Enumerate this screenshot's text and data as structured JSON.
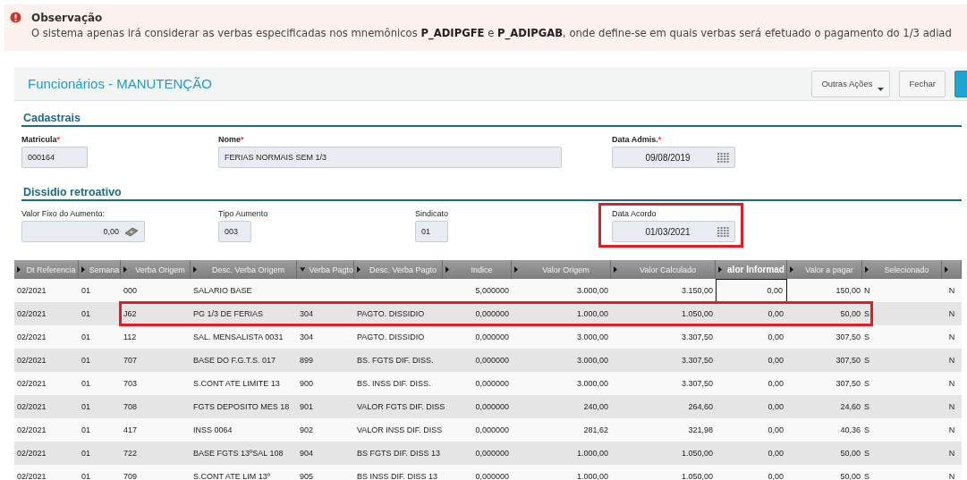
{
  "notice": {
    "title": "Observação",
    "text": "O sistema apenas irá considerar as verbas especificadas nos mnemônicos **P_ADIPGFE** e **P_ADIPGAB**, onde define-se em quais verbas será efetuado o pagamento do 1/3 adiad"
  },
  "page": {
    "title": "Funcionários - MANUTENÇÃO",
    "actions": [
      {
        "label": "Outras Ações",
        "kind": "menu"
      },
      {
        "label": "Fechar",
        "kind": "plain"
      },
      {
        "kind": "primary"
      }
    ]
  },
  "sections": [
    {
      "title": "Cadastrais",
      "fields": [
        {
          "label": "Matricula",
          "marker": "*",
          "value": "000164",
          "kind": "text",
          "highlighted": false
        },
        {
          "label": "Nome",
          "marker": "*",
          "value": "FERIAS NORMAIS SEM 1/3",
          "kind": "text",
          "highlighted": false
        },
        {
          "label": "Data Admis.",
          "marker": "*",
          "value": "09/08/2019",
          "kind": "date",
          "highlighted": false
        }
      ]
    },
    {
      "title": "Dissidio retroativo",
      "fields": [
        {
          "label": "Valor Fixo do Aumento:",
          "value": "0,00",
          "kind": "money",
          "highlighted": false
        },
        {
          "label": "Tipo Aumento",
          "value": "003",
          "kind": "text",
          "highlighted": false
        },
        {
          "label": "Sindicato",
          "value": "01",
          "kind": "text",
          "highlighted": false
        },
        {
          "label": "Data Acordo",
          "value": "01/03/2021",
          "kind": "date",
          "highlighted": true
        }
      ]
    }
  ],
  "table": {
    "columns": [
      {
        "label": "Dt Referencia"
      },
      {
        "label": "Semana"
      },
      {
        "label": "Verba Origem"
      },
      {
        "label": "Desc. Verba Origem"
      },
      {
        "label": "Verba Pagto",
        "sorted": true
      },
      {
        "label": "Desc. Verba Pagto"
      },
      {
        "label": "Indice"
      },
      {
        "label": "Valor Origem"
      },
      {
        "label": "Valor Calculado"
      },
      {
        "label": "alor Informad",
        "active": true
      },
      {
        "label": "Valor a pagar"
      },
      {
        "label": "Selecionado"
      },
      {}
    ],
    "rows": [
      {
        "highlighted": false,
        "editing": true,
        "cells": [
          "02/2021",
          "01",
          "000",
          "SALARIO BASE",
          "",
          "",
          "5,000000",
          "3.000,00",
          "3.150,00",
          "0,00",
          "150,00",
          "N",
          "N"
        ]
      },
      {
        "highlighted": true,
        "editing": false,
        "cells": [
          "02/2021",
          "01",
          "J62",
          "PG 1/3 DE FERIAS",
          "304",
          "PAGTO. DISSIDIO",
          "0,000000",
          "1.000,00",
          "1.050,00",
          "0,00",
          "50,00",
          "S",
          "N"
        ]
      },
      {
        "highlighted": false,
        "editing": false,
        "cells": [
          "02/2021",
          "01",
          "112",
          "SAL. MENSALISTA 0031",
          "304",
          "PAGTO. DISSIDIO",
          "0,000000",
          "3.000,00",
          "3.307,50",
          "0,00",
          "307,50",
          "S",
          "N"
        ]
      },
      {
        "highlighted": false,
        "editing": false,
        "cells": [
          "02/2021",
          "01",
          "707",
          "BASE DO F.G.T.S. 017",
          "899",
          "BS. FGTS DIF. DISS.",
          "0,000000",
          "3.000,00",
          "3.307,50",
          "0,00",
          "307,50",
          "S",
          "N"
        ]
      },
      {
        "highlighted": false,
        "editing": false,
        "cells": [
          "02/2021",
          "01",
          "703",
          "S.CONT ATE LIMITE 13",
          "900",
          "BS. INSS DIF. DISS.",
          "0,000000",
          "3.000,00",
          "3.307,50",
          "0,00",
          "307,50",
          "S",
          "N"
        ]
      },
      {
        "highlighted": false,
        "editing": false,
        "cells": [
          "02/2021",
          "01",
          "708",
          "FGTS DEPOSITO MES 18",
          "901",
          "VALOR FGTS DIF. DISS",
          "0,000000",
          "240,00",
          "264,60",
          "0,00",
          "24,60",
          "S",
          "N"
        ]
      },
      {
        "highlighted": false,
        "editing": false,
        "cells": [
          "02/2021",
          "01",
          "417",
          "INSS 0064",
          "902",
          "VALOR INSS DIF. DISS",
          "0,000000",
          "281,62",
          "321,98",
          "0,00",
          "40,36",
          "S",
          "N"
        ]
      },
      {
        "highlighted": false,
        "editing": false,
        "cells": [
          "02/2021",
          "01",
          "722",
          "BASE FGTS 13ºSAL 108",
          "904",
          "BS FGTS DIF. DISS 13",
          "0,000000",
          "1.000,00",
          "1.050,00",
          "0,00",
          "50,00",
          "S",
          "N"
        ]
      },
      {
        "highlighted": false,
        "editing": false,
        "cells": [
          "02/2021",
          "01",
          "709",
          "S.CONT ATE LIM 13º",
          "905",
          "BS INSS DIF. DISS 13",
          "0,000000",
          "1.000,00",
          "1.050,00",
          "0,00",
          "50,00",
          "S",
          "N"
        ]
      }
    ]
  }
}
